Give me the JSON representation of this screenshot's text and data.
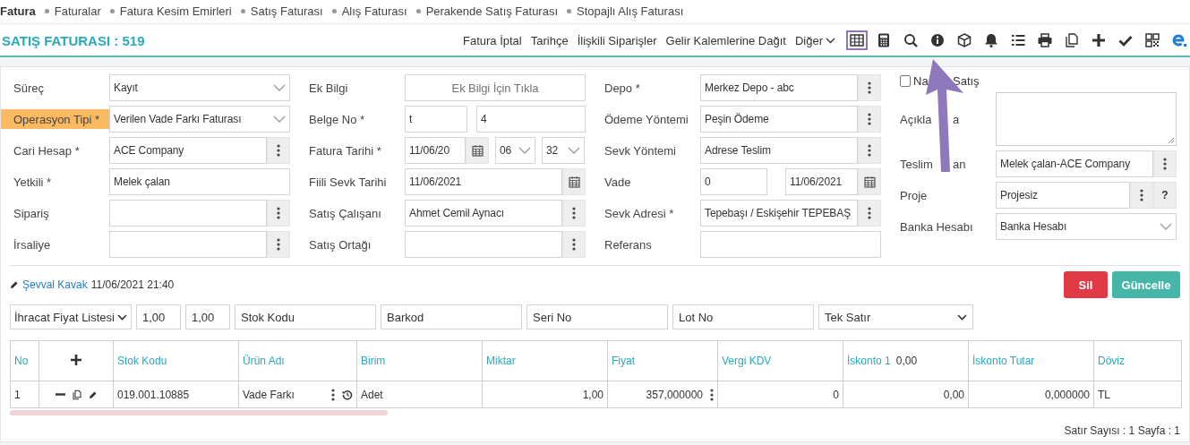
{
  "breadcrumbs": [
    {
      "label": "Fatura",
      "selected": true
    },
    {
      "label": "Faturalar",
      "selected": false
    },
    {
      "label": "Fatura Kesim Emirleri",
      "selected": false
    },
    {
      "label": "Satış Faturası",
      "selected": false
    },
    {
      "label": "Alış Faturası",
      "selected": false
    },
    {
      "label": "Perakende Satış Faturası",
      "selected": false
    },
    {
      "label": "Stopajlı Alış Faturası",
      "selected": false
    }
  ],
  "header": {
    "title": "SATIŞ FATURASI : 519",
    "links": [
      "Fatura İptal",
      "Tarihçe",
      "İlişkili Siparişler",
      "Gelir Kalemlerine Dağıt"
    ],
    "more": "Diğer",
    "icons": [
      {
        "kind": "table",
        "highlighted": true
      },
      {
        "kind": "calculator",
        "highlighted": false
      },
      {
        "kind": "search",
        "highlighted": false
      },
      {
        "kind": "info",
        "highlighted": false
      },
      {
        "kind": "box",
        "highlighted": false
      },
      {
        "kind": "bell",
        "highlighted": false
      },
      {
        "kind": "list",
        "highlighted": false
      },
      {
        "kind": "print",
        "highlighted": false
      },
      {
        "kind": "copy",
        "highlighted": false
      },
      {
        "kind": "plus",
        "highlighted": false
      },
      {
        "kind": "check",
        "highlighted": false
      },
      {
        "kind": "qr",
        "highlighted": false
      },
      {
        "kind": "logo",
        "highlighted": false
      }
    ]
  },
  "form": {
    "columns": [
      [
        {
          "label": "Süreç",
          "kind": "select",
          "value": "Kayıt",
          "highlighted": false
        },
        {
          "label": "Operasyon Tipi *",
          "kind": "select",
          "value": "Verilen Vade Farkı Faturası",
          "highlighted": true
        },
        {
          "label": "Cari Hesap *",
          "kind": "lookup",
          "value": "ACE Company",
          "highlighted": false
        },
        {
          "label": "Yetkili *",
          "kind": "text",
          "value": "Melek çalan",
          "highlighted": false
        },
        {
          "label": "Sipariş",
          "kind": "lookup",
          "highlighted": false
        },
        {
          "label": "İrsaliye",
          "kind": "lookup",
          "highlighted": false
        }
      ],
      [
        {
          "label": "Ek Bilgi",
          "kind": "hint",
          "placeholder": "Ek Bilgi İçin Tıkla",
          "highlighted": false
        },
        {
          "label": "Belge No *",
          "kind": "pair",
          "values": [
            "t",
            "4"
          ],
          "highlighted": false
        },
        {
          "label": "Fatura Tarihi *",
          "kind": "datetime",
          "value": "11/06/20",
          "hour": "06",
          "minute": "32",
          "highlighted": false
        },
        {
          "label": "Fiili Sevk Tarihi",
          "kind": "date",
          "value": "11/06/2021",
          "highlighted": false
        },
        {
          "label": "Satış Çalışanı",
          "kind": "lookup",
          "value": "Ahmet Cemil Aynacı",
          "highlighted": false
        },
        {
          "label": "Satış Ortağı",
          "kind": "lookup",
          "highlighted": false
        }
      ],
      [
        {
          "label": "Depo *",
          "kind": "lookup",
          "value": "Merkez Depo - abc",
          "highlighted": false
        },
        {
          "label": "Ödeme Yöntemi",
          "kind": "lookup",
          "value": "Peşin Ödeme",
          "highlighted": false
        },
        {
          "label": "Sevk Yöntemi",
          "kind": "lookup",
          "value": "Adrese Teslim",
          "highlighted": false
        },
        {
          "label": "Vade",
          "kind": "days_date",
          "value": "0",
          "date": "11/06/2021",
          "highlighted": false
        },
        {
          "label": "Sevk Adresi *",
          "kind": "lookup",
          "value": "Tepebaşı / Eskişehir TEPEBAŞ",
          "highlighted": false
        },
        {
          "label": "Referans",
          "kind": "text",
          "highlighted": false
        }
      ]
    ],
    "cash_sale": {
      "label_parts": [
        "Na",
        "Satış"
      ],
      "checked": false
    },
    "note": {
      "label_parts": [
        "Açıkla",
        "a"
      ]
    },
    "side": [
      {
        "label_parts": [
          "Teslim",
          "an"
        ],
        "kind": "lookup",
        "value": "Melek çalan-ACE Company"
      },
      {
        "label": "Proje",
        "kind": "lookup_help",
        "value": "Projesiz",
        "help": "?"
      },
      {
        "label": "Banka Hesabı",
        "kind": "select",
        "value": "Banka Hesabı"
      }
    ]
  },
  "audit": {
    "user": "Şevval Kavak",
    "time": "11/06/2021 21:40"
  },
  "actions": [
    {
      "label": "Sil",
      "kind": "danger"
    },
    {
      "label": "Güncelle",
      "kind": "primary"
    }
  ],
  "line_tools": {
    "price_list": "İhracat Fiyat Listesi",
    "rates": [
      "1,00",
      "1,00"
    ],
    "inputs": [
      "Stok Kodu",
      "Barkod",
      "Seri No",
      "Lot No"
    ],
    "mode": "Tek Satır"
  },
  "table": {
    "columns": [
      {
        "label": "No",
        "kind": "text"
      },
      {
        "kind": "tools"
      },
      {
        "label": "Stok Kodu",
        "kind": "text"
      },
      {
        "label": "Ürün Adı",
        "kind": "product"
      },
      {
        "label": "Birim",
        "kind": "text"
      },
      {
        "label": "Miktar",
        "kind": "number"
      },
      {
        "label": "Fiyat",
        "kind": "price"
      },
      {
        "label": "Vergi KDV",
        "kind": "number"
      },
      {
        "label": "İskonto 1",
        "extra": "0,00",
        "kind": "number"
      },
      {
        "label": "İskonto Tutar",
        "kind": "number"
      },
      {
        "label": "Döviz",
        "kind": "text"
      }
    ],
    "rows": [
      {
        "cells": [
          "1",
          "",
          "019.001.10885",
          "Vade Farkı",
          "Adet",
          "1,00",
          "357,000000",
          "0",
          "0,00",
          "0,000000",
          "TL"
        ]
      }
    ]
  },
  "footer": "Satır Sayısı : 1 Sayfa : 1"
}
